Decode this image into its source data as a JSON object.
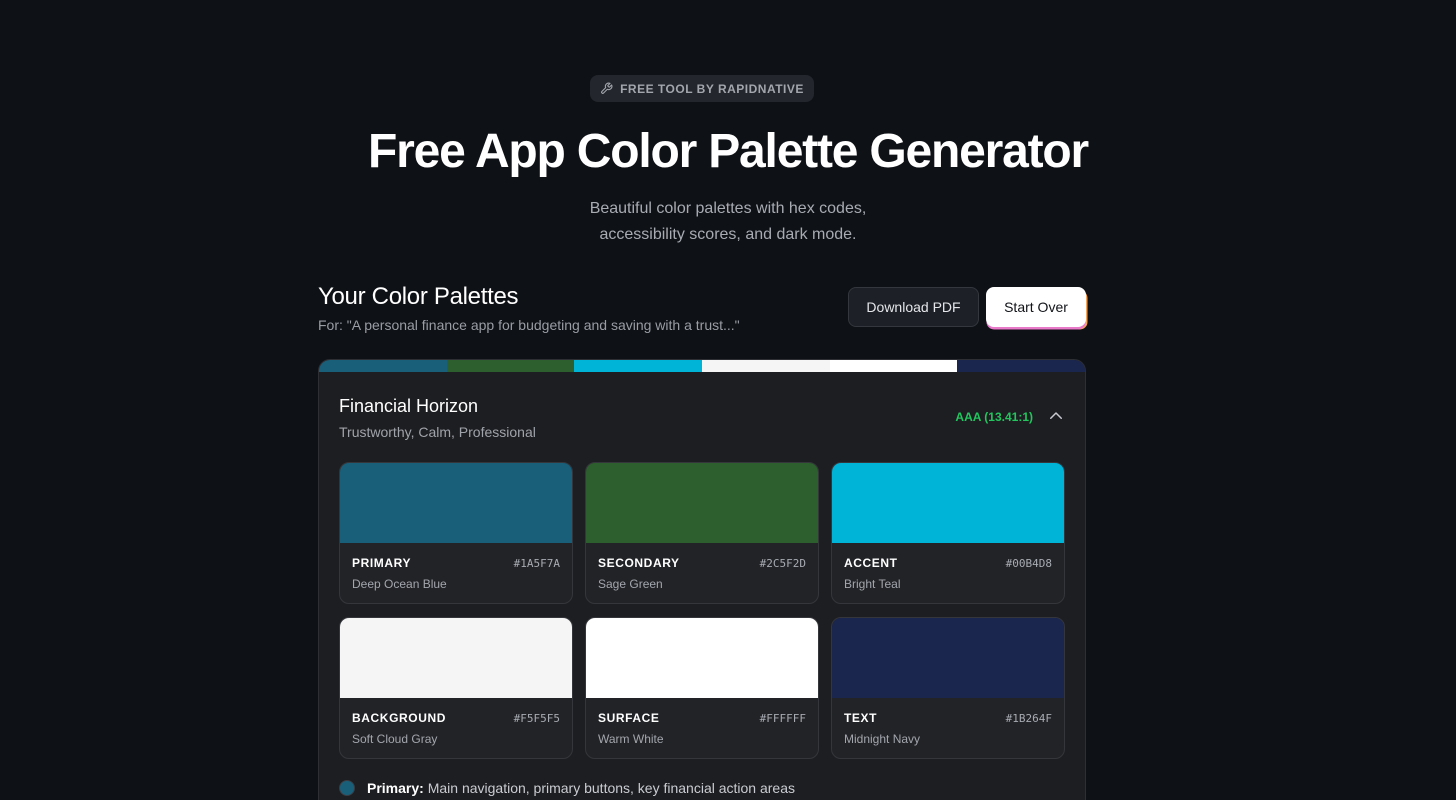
{
  "badge": {
    "icon": "wrench-icon",
    "label": "FREE TOOL BY RAPIDNATIVE"
  },
  "hero": {
    "title": "Free App Color Palette Generator",
    "subtitle_line1": "Beautiful color palettes with hex codes,",
    "subtitle_line2": "accessibility scores, and dark mode."
  },
  "section": {
    "title": "Your Color Palettes",
    "for_text": "For: \"A personal finance app for budgeting and saving with a trust...\"",
    "download_label": "Download PDF",
    "start_over_label": "Start Over"
  },
  "palette": {
    "name": "Financial Horizon",
    "tags": "Trustworthy, Calm, Professional",
    "score": "AAA (13.41:1)",
    "collapse_icon": "chevron-up-icon",
    "colors": [
      {
        "role": "PRIMARY",
        "hex": "#1A5F7A",
        "name": "Deep Ocean Blue"
      },
      {
        "role": "SECONDARY",
        "hex": "#2C5F2D",
        "name": "Sage Green"
      },
      {
        "role": "ACCENT",
        "hex": "#00B4D8",
        "name": "Bright Teal"
      },
      {
        "role": "BACKGROUND",
        "hex": "#F5F5F5",
        "name": "Soft Cloud Gray"
      },
      {
        "role": "SURFACE",
        "hex": "#FFFFFF",
        "name": "Warm White"
      },
      {
        "role": "TEXT",
        "hex": "#1B264F",
        "name": "Midnight Navy"
      }
    ],
    "usage": [
      {
        "label": "Primary:",
        "text": "Main navigation, primary buttons, key financial action areas",
        "color": "#1A5F7A"
      }
    ]
  }
}
